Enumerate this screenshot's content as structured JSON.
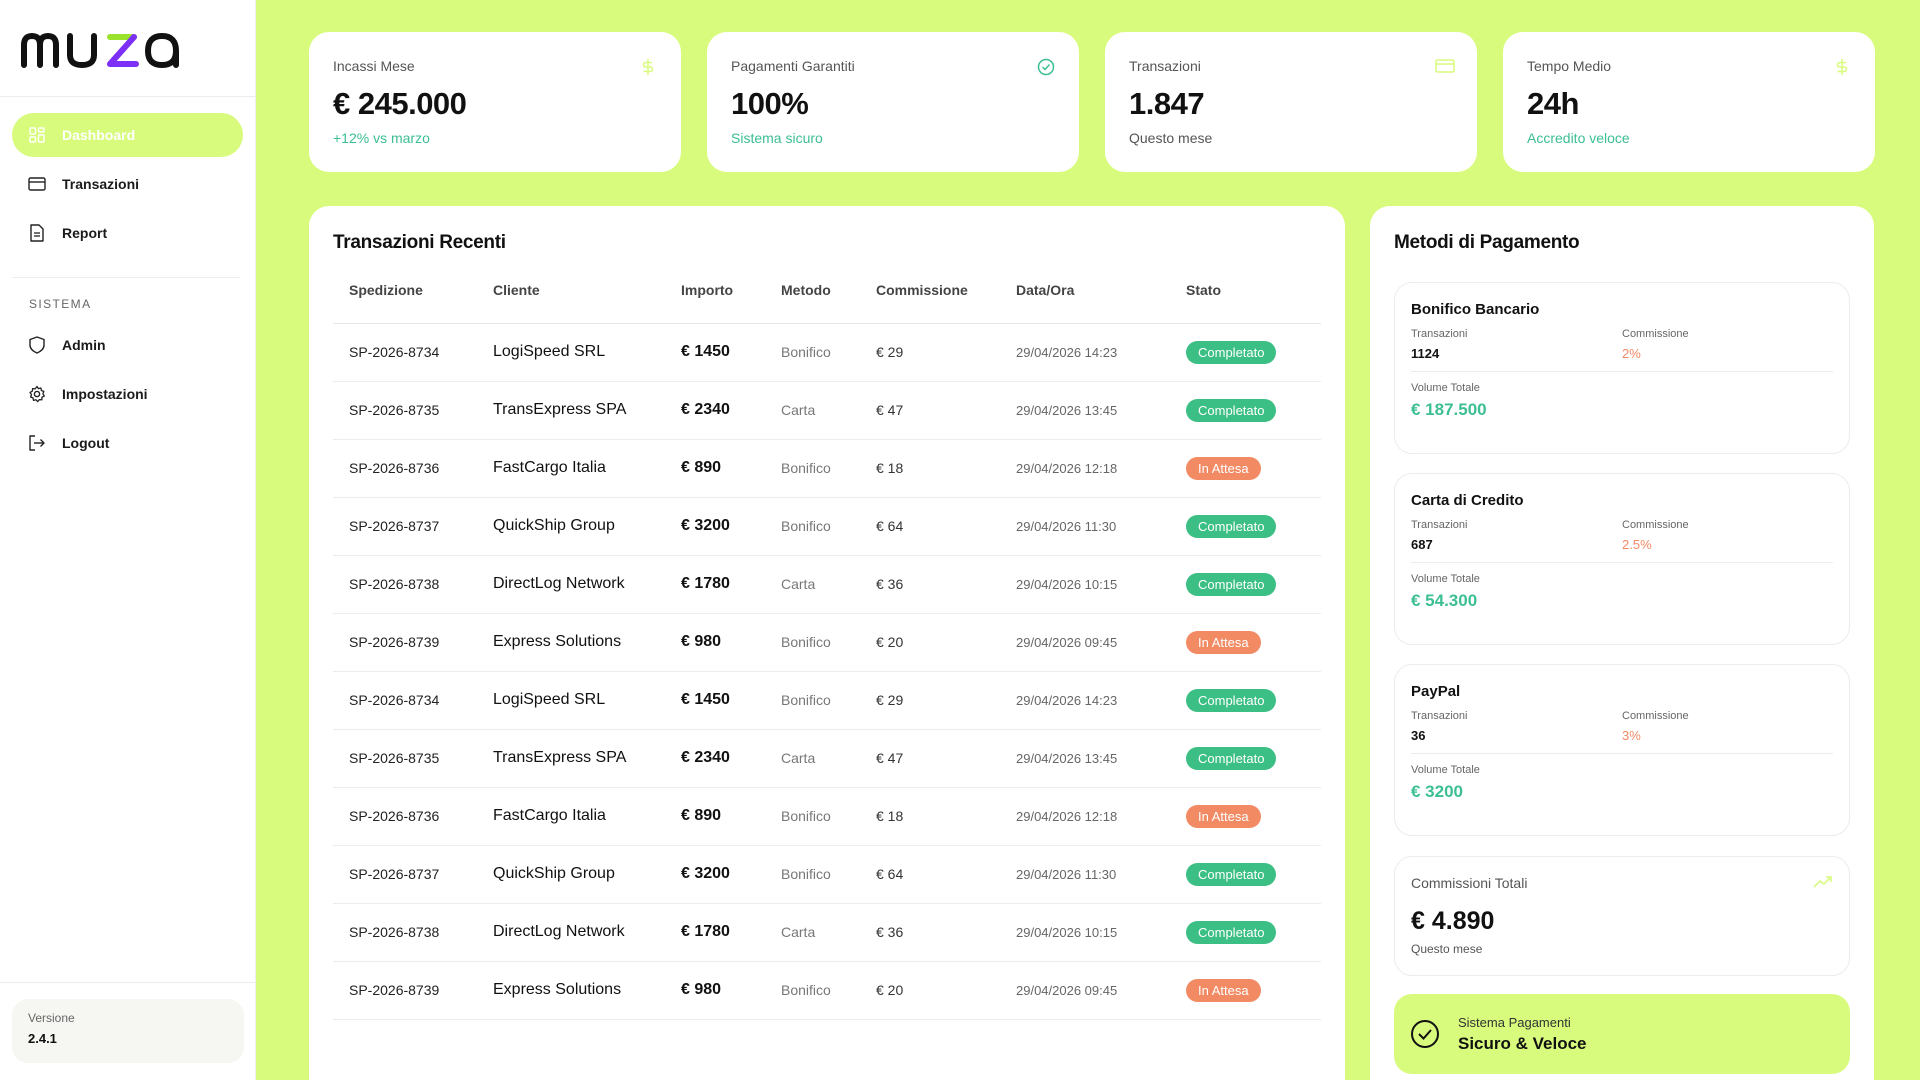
{
  "brand": {
    "name": "muza",
    "accent": "#d8fb7d",
    "success": "#3cbf84",
    "warning": "#f28a64"
  },
  "sidebar": {
    "items": [
      {
        "label": "Dashboard",
        "icon": "dashboard-icon",
        "active": true
      },
      {
        "label": "Transazioni",
        "icon": "card-icon"
      },
      {
        "label": "Report",
        "icon": "document-icon"
      }
    ],
    "section_label": "SISTEMA",
    "system_items": [
      {
        "label": "Admin",
        "icon": "shield-icon"
      },
      {
        "label": "Impostazioni",
        "icon": "gear-icon"
      },
      {
        "label": "Logout",
        "icon": "logout-icon"
      }
    ],
    "version_label": "Versione",
    "version_value": "2.4.1"
  },
  "stats": [
    {
      "label": "Incassi Mese",
      "value": "€ 245.000",
      "sub": "+12% vs marzo",
      "icon": "dollar-icon"
    },
    {
      "label": "Pagamenti Garantiti",
      "value": "100%",
      "sub": "Sistema sicuro",
      "icon": "check-circle-icon"
    },
    {
      "label": "Transazioni",
      "value": "1.847",
      "sub": "Questo mese",
      "icon": "card-icon"
    },
    {
      "label": "Tempo Medio",
      "value": "24h",
      "sub": "Accredito veloce",
      "icon": "dollar-icon"
    }
  ],
  "transactions": {
    "title": "Transazioni Recenti",
    "columns": [
      "Spedizione",
      "Cliente",
      "Importo",
      "Metodo",
      "Commissione",
      "Data/Ora",
      "Stato"
    ],
    "rows": [
      {
        "id": "SP-2026-8734",
        "client": "LogiSpeed SRL",
        "amount": "€ 1450",
        "method": "Bonifico",
        "fee": "€ 29",
        "date": "29/04/2026 14:23",
        "status": "Completato"
      },
      {
        "id": "SP-2026-8735",
        "client": "TransExpress SPA",
        "amount": "€ 2340",
        "method": "Carta",
        "fee": "€ 47",
        "date": "29/04/2026 13:45",
        "status": "Completato"
      },
      {
        "id": "SP-2026-8736",
        "client": "FastCargo Italia",
        "amount": "€ 890",
        "method": "Bonifico",
        "fee": "€ 18",
        "date": "29/04/2026 12:18",
        "status": "In Attesa"
      },
      {
        "id": "SP-2026-8737",
        "client": "QuickShip Group",
        "amount": "€ 3200",
        "method": "Bonifico",
        "fee": "€ 64",
        "date": "29/04/2026 11:30",
        "status": "Completato"
      },
      {
        "id": "SP-2026-8738",
        "client": "DirectLog Network",
        "amount": "€ 1780",
        "method": "Carta",
        "fee": "€ 36",
        "date": "29/04/2026 10:15",
        "status": "Completato"
      },
      {
        "id": "SP-2026-8739",
        "client": "Express Solutions",
        "amount": "€ 980",
        "method": "Bonifico",
        "fee": "€ 20",
        "date": "29/04/2026 09:45",
        "status": "In Attesa"
      },
      {
        "id": "SP-2026-8734",
        "client": "LogiSpeed SRL",
        "amount": "€ 1450",
        "method": "Bonifico",
        "fee": "€ 29",
        "date": "29/04/2026 14:23",
        "status": "Completato"
      },
      {
        "id": "SP-2026-8735",
        "client": "TransExpress SPA",
        "amount": "€ 2340",
        "method": "Carta",
        "fee": "€ 47",
        "date": "29/04/2026 13:45",
        "status": "Completato"
      },
      {
        "id": "SP-2026-8736",
        "client": "FastCargo Italia",
        "amount": "€ 890",
        "method": "Bonifico",
        "fee": "€ 18",
        "date": "29/04/2026 12:18",
        "status": "In Attesa"
      },
      {
        "id": "SP-2026-8737",
        "client": "QuickShip Group",
        "amount": "€ 3200",
        "method": "Bonifico",
        "fee": "€ 64",
        "date": "29/04/2026 11:30",
        "status": "Completato"
      },
      {
        "id": "SP-2026-8738",
        "client": "DirectLog Network",
        "amount": "€ 1780",
        "method": "Carta",
        "fee": "€ 36",
        "date": "29/04/2026 10:15",
        "status": "Completato"
      },
      {
        "id": "SP-2026-8739",
        "client": "Express Solutions",
        "amount": "€ 980",
        "method": "Bonifico",
        "fee": "€ 20",
        "date": "29/04/2026 09:45",
        "status": "In Attesa"
      }
    ]
  },
  "methods": {
    "title": "Metodi di Pagamento",
    "tx_label": "Transazioni",
    "fee_label": "Commissione",
    "volume_label": "Volume Totale",
    "items": [
      {
        "name": "Bonifico Bancario",
        "count": "1124",
        "fee": "2%",
        "volume": "€ 187.500"
      },
      {
        "name": "Carta di Credito",
        "count": "687",
        "fee": "2.5%",
        "volume": "€ 54.300"
      },
      {
        "name": "PayPal",
        "count": "36",
        "fee": "3%",
        "volume": "€ 3200"
      }
    ],
    "commissions": {
      "label": "Commissioni Totali",
      "value": "€ 4.890",
      "sub": "Questo mese"
    },
    "system": {
      "small": "Sistema Pagamenti",
      "big": "Sicuro & Veloce"
    }
  }
}
